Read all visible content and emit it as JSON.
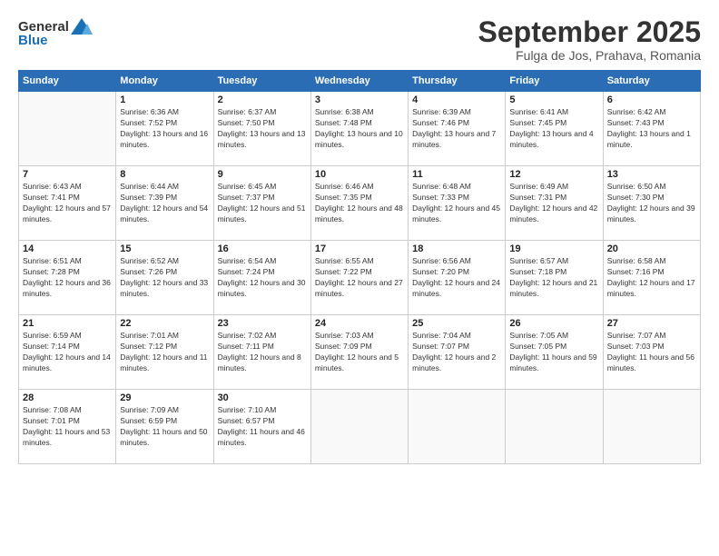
{
  "logo": {
    "line1": "General",
    "line2": "Blue"
  },
  "header": {
    "month": "September 2025",
    "location": "Fulga de Jos, Prahava, Romania"
  },
  "weekdays": [
    "Sunday",
    "Monday",
    "Tuesday",
    "Wednesday",
    "Thursday",
    "Friday",
    "Saturday"
  ],
  "weeks": [
    [
      {
        "day": "",
        "sunrise": "",
        "sunset": "",
        "daylight": ""
      },
      {
        "day": "1",
        "sunrise": "Sunrise: 6:36 AM",
        "sunset": "Sunset: 7:52 PM",
        "daylight": "Daylight: 13 hours and 16 minutes."
      },
      {
        "day": "2",
        "sunrise": "Sunrise: 6:37 AM",
        "sunset": "Sunset: 7:50 PM",
        "daylight": "Daylight: 13 hours and 13 minutes."
      },
      {
        "day": "3",
        "sunrise": "Sunrise: 6:38 AM",
        "sunset": "Sunset: 7:48 PM",
        "daylight": "Daylight: 13 hours and 10 minutes."
      },
      {
        "day": "4",
        "sunrise": "Sunrise: 6:39 AM",
        "sunset": "Sunset: 7:46 PM",
        "daylight": "Daylight: 13 hours and 7 minutes."
      },
      {
        "day": "5",
        "sunrise": "Sunrise: 6:41 AM",
        "sunset": "Sunset: 7:45 PM",
        "daylight": "Daylight: 13 hours and 4 minutes."
      },
      {
        "day": "6",
        "sunrise": "Sunrise: 6:42 AM",
        "sunset": "Sunset: 7:43 PM",
        "daylight": "Daylight: 13 hours and 1 minute."
      }
    ],
    [
      {
        "day": "7",
        "sunrise": "Sunrise: 6:43 AM",
        "sunset": "Sunset: 7:41 PM",
        "daylight": "Daylight: 12 hours and 57 minutes."
      },
      {
        "day": "8",
        "sunrise": "Sunrise: 6:44 AM",
        "sunset": "Sunset: 7:39 PM",
        "daylight": "Daylight: 12 hours and 54 minutes."
      },
      {
        "day": "9",
        "sunrise": "Sunrise: 6:45 AM",
        "sunset": "Sunset: 7:37 PM",
        "daylight": "Daylight: 12 hours and 51 minutes."
      },
      {
        "day": "10",
        "sunrise": "Sunrise: 6:46 AM",
        "sunset": "Sunset: 7:35 PM",
        "daylight": "Daylight: 12 hours and 48 minutes."
      },
      {
        "day": "11",
        "sunrise": "Sunrise: 6:48 AM",
        "sunset": "Sunset: 7:33 PM",
        "daylight": "Daylight: 12 hours and 45 minutes."
      },
      {
        "day": "12",
        "sunrise": "Sunrise: 6:49 AM",
        "sunset": "Sunset: 7:31 PM",
        "daylight": "Daylight: 12 hours and 42 minutes."
      },
      {
        "day": "13",
        "sunrise": "Sunrise: 6:50 AM",
        "sunset": "Sunset: 7:30 PM",
        "daylight": "Daylight: 12 hours and 39 minutes."
      }
    ],
    [
      {
        "day": "14",
        "sunrise": "Sunrise: 6:51 AM",
        "sunset": "Sunset: 7:28 PM",
        "daylight": "Daylight: 12 hours and 36 minutes."
      },
      {
        "day": "15",
        "sunrise": "Sunrise: 6:52 AM",
        "sunset": "Sunset: 7:26 PM",
        "daylight": "Daylight: 12 hours and 33 minutes."
      },
      {
        "day": "16",
        "sunrise": "Sunrise: 6:54 AM",
        "sunset": "Sunset: 7:24 PM",
        "daylight": "Daylight: 12 hours and 30 minutes."
      },
      {
        "day": "17",
        "sunrise": "Sunrise: 6:55 AM",
        "sunset": "Sunset: 7:22 PM",
        "daylight": "Daylight: 12 hours and 27 minutes."
      },
      {
        "day": "18",
        "sunrise": "Sunrise: 6:56 AM",
        "sunset": "Sunset: 7:20 PM",
        "daylight": "Daylight: 12 hours and 24 minutes."
      },
      {
        "day": "19",
        "sunrise": "Sunrise: 6:57 AM",
        "sunset": "Sunset: 7:18 PM",
        "daylight": "Daylight: 12 hours and 21 minutes."
      },
      {
        "day": "20",
        "sunrise": "Sunrise: 6:58 AM",
        "sunset": "Sunset: 7:16 PM",
        "daylight": "Daylight: 12 hours and 17 minutes."
      }
    ],
    [
      {
        "day": "21",
        "sunrise": "Sunrise: 6:59 AM",
        "sunset": "Sunset: 7:14 PM",
        "daylight": "Daylight: 12 hours and 14 minutes."
      },
      {
        "day": "22",
        "sunrise": "Sunrise: 7:01 AM",
        "sunset": "Sunset: 7:12 PM",
        "daylight": "Daylight: 12 hours and 11 minutes."
      },
      {
        "day": "23",
        "sunrise": "Sunrise: 7:02 AM",
        "sunset": "Sunset: 7:11 PM",
        "daylight": "Daylight: 12 hours and 8 minutes."
      },
      {
        "day": "24",
        "sunrise": "Sunrise: 7:03 AM",
        "sunset": "Sunset: 7:09 PM",
        "daylight": "Daylight: 12 hours and 5 minutes."
      },
      {
        "day": "25",
        "sunrise": "Sunrise: 7:04 AM",
        "sunset": "Sunset: 7:07 PM",
        "daylight": "Daylight: 12 hours and 2 minutes."
      },
      {
        "day": "26",
        "sunrise": "Sunrise: 7:05 AM",
        "sunset": "Sunset: 7:05 PM",
        "daylight": "Daylight: 11 hours and 59 minutes."
      },
      {
        "day": "27",
        "sunrise": "Sunrise: 7:07 AM",
        "sunset": "Sunset: 7:03 PM",
        "daylight": "Daylight: 11 hours and 56 minutes."
      }
    ],
    [
      {
        "day": "28",
        "sunrise": "Sunrise: 7:08 AM",
        "sunset": "Sunset: 7:01 PM",
        "daylight": "Daylight: 11 hours and 53 minutes."
      },
      {
        "day": "29",
        "sunrise": "Sunrise: 7:09 AM",
        "sunset": "Sunset: 6:59 PM",
        "daylight": "Daylight: 11 hours and 50 minutes."
      },
      {
        "day": "30",
        "sunrise": "Sunrise: 7:10 AM",
        "sunset": "Sunset: 6:57 PM",
        "daylight": "Daylight: 11 hours and 46 minutes."
      },
      {
        "day": "",
        "sunrise": "",
        "sunset": "",
        "daylight": ""
      },
      {
        "day": "",
        "sunrise": "",
        "sunset": "",
        "daylight": ""
      },
      {
        "day": "",
        "sunrise": "",
        "sunset": "",
        "daylight": ""
      },
      {
        "day": "",
        "sunrise": "",
        "sunset": "",
        "daylight": ""
      }
    ]
  ]
}
